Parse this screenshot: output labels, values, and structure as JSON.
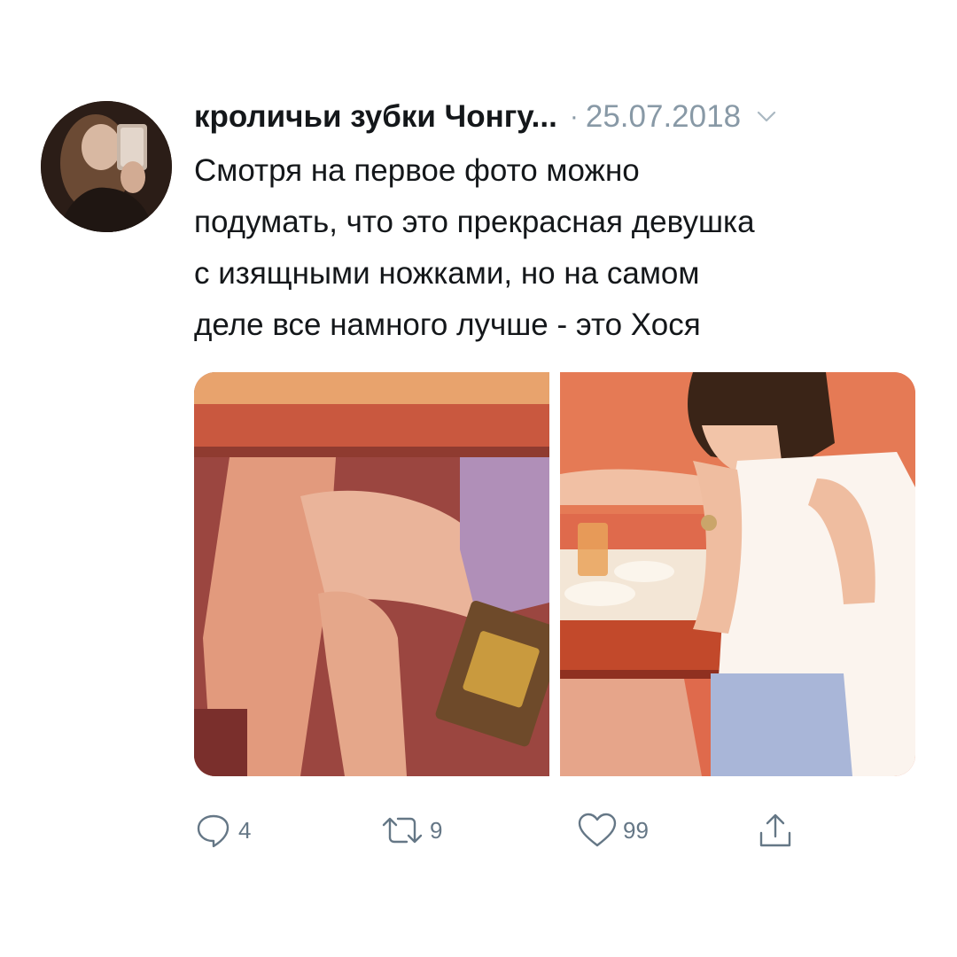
{
  "tweet": {
    "author": {
      "display_name": "кроличьи зубки Чонгу...",
      "avatar_icon": "profile-avatar"
    },
    "separator": "·",
    "date": "25.07.2018",
    "menu_icon": "chevron-down-icon",
    "text_lines": [
      "Смотря на первое фото можно",
      "подумать, что это прекрасная девушка",
      "с изящными ножками, но на самом",
      "деле все намного лучше - это Хося"
    ],
    "media": [
      {
        "alt": "photo-legs-under-table"
      },
      {
        "alt": "photo-person-at-table"
      }
    ],
    "actions": {
      "reply": {
        "icon": "reply-icon",
        "count": "4"
      },
      "retweet": {
        "icon": "retweet-icon",
        "count": "9"
      },
      "like": {
        "icon": "heart-icon",
        "count": "99"
      },
      "share": {
        "icon": "share-icon"
      }
    },
    "colors": {
      "text": "#14171a",
      "secondary": "#8899a6",
      "action": "#657786"
    }
  }
}
